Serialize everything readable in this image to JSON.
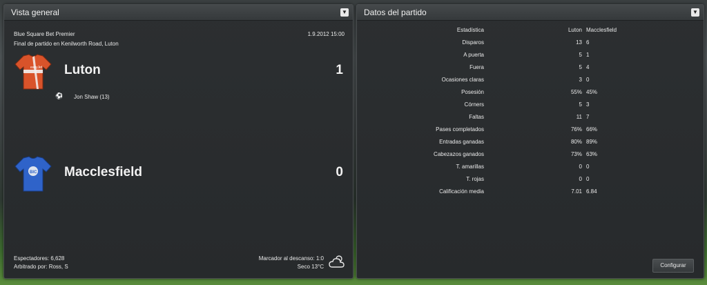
{
  "overview": {
    "title": "Vista general",
    "competition": "Blue Square Bet Premier",
    "datetime": "1.9.2012 15:00",
    "venue": "Final de partido en Kenilworth Road, Luton",
    "home": {
      "name": "Luton",
      "score": "1",
      "kit_color": "#d9532a",
      "scorer": "Jon Shaw (13)"
    },
    "away": {
      "name": "Macclesfield",
      "score": "0",
      "kit_color": "#2f63c9"
    },
    "attendance": "Espectadores: 6,628",
    "referee": "Arbitrado por: Ross, S",
    "halftime": "Marcador al descanso: 1:0",
    "weather": "Seco 13°C",
    "weather_icon": "cloud-sun-icon"
  },
  "match_stats": {
    "title": "Datos del partido",
    "header": {
      "label": "Estadística",
      "home": "Luton",
      "away": "Macclesfield"
    },
    "rows": [
      {
        "label": "Disparos",
        "home": "13",
        "away": "6"
      },
      {
        "label": "A puerta",
        "home": "5",
        "away": "1"
      },
      {
        "label": "Fuera",
        "home": "5",
        "away": "4"
      },
      {
        "label": "Ocasiones claras",
        "home": "3",
        "away": "0"
      },
      {
        "label": "Posesión",
        "home": "55%",
        "away": "45%"
      },
      {
        "label": "Córners",
        "home": "5",
        "away": "3"
      },
      {
        "label": "Faltas",
        "home": "11",
        "away": "7"
      },
      {
        "label": "Pases completados",
        "home": "76%",
        "away": "66%"
      },
      {
        "label": "Entradas ganadas",
        "home": "80%",
        "away": "89%"
      },
      {
        "label": "Cabezazos ganados",
        "home": "73%",
        "away": "63%"
      },
      {
        "label": "T. amarillas",
        "home": "0",
        "away": "0"
      },
      {
        "label": "T. rojas",
        "home": "0",
        "away": "0"
      },
      {
        "label": "Calificación media",
        "home": "7.01",
        "away": "6.84"
      }
    ],
    "configure_label": "Configurar"
  }
}
